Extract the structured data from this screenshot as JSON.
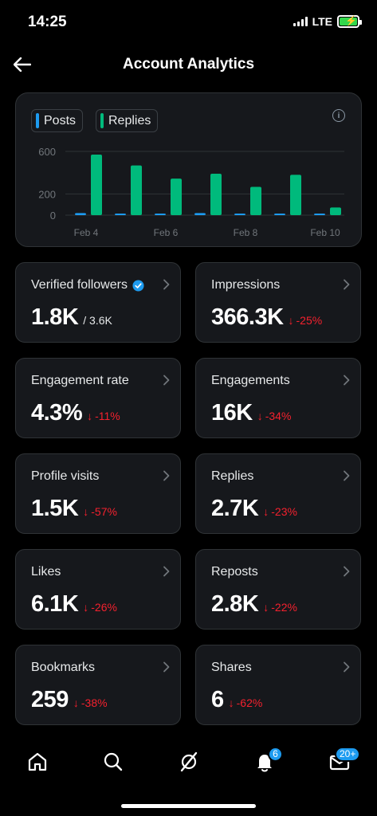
{
  "status_bar": {
    "time": "14:25",
    "network": "LTE"
  },
  "header": {
    "title": "Account Analytics"
  },
  "chart": {
    "legend": [
      {
        "label": "Posts",
        "color": "#1d9bf0"
      },
      {
        "label": "Replies",
        "color": "#00ba7c"
      }
    ]
  },
  "chart_data": {
    "type": "bar",
    "categories": [
      "Feb 4",
      "Feb 5",
      "Feb 6",
      "Feb 7",
      "Feb 8",
      "Feb 9",
      "Feb 10"
    ],
    "x_tick_labels": [
      "Feb 4",
      "Feb 6",
      "Feb 8",
      "Feb 10"
    ],
    "y_tick_labels": [
      "600",
      "200",
      "0"
    ],
    "ylim": [
      0,
      600
    ],
    "series": [
      {
        "name": "Posts",
        "color": "#1d9bf0",
        "values": [
          20,
          15,
          15,
          20,
          10,
          12,
          8
        ]
      },
      {
        "name": "Replies",
        "color": "#00ba7c",
        "values": [
          570,
          468,
          344,
          390,
          266,
          380,
          72
        ]
      }
    ],
    "grid": true
  },
  "metrics": [
    {
      "label": "Verified followers",
      "value": "1.8K",
      "sub": "/ 3.6K",
      "change": "",
      "verified": true
    },
    {
      "label": "Impressions",
      "value": "366.3K",
      "sub": "",
      "change": "-25%"
    },
    {
      "label": "Engagement rate",
      "value": "4.3%",
      "sub": "",
      "change": "-11%"
    },
    {
      "label": "Engagements",
      "value": "16K",
      "sub": "",
      "change": "-34%"
    },
    {
      "label": "Profile visits",
      "value": "1.5K",
      "sub": "",
      "change": "-57%"
    },
    {
      "label": "Replies",
      "value": "2.7K",
      "sub": "",
      "change": "-23%"
    },
    {
      "label": "Likes",
      "value": "6.1K",
      "sub": "",
      "change": "-26%"
    },
    {
      "label": "Reposts",
      "value": "2.8K",
      "sub": "",
      "change": "-22%"
    },
    {
      "label": "Bookmarks",
      "value": "259",
      "sub": "",
      "change": "-38%"
    },
    {
      "label": "Shares",
      "value": "6",
      "sub": "",
      "change": "-62%"
    }
  ],
  "bottom_nav": {
    "items": [
      "home-icon",
      "search-icon",
      "grok-icon",
      "bell-icon",
      "mail-icon"
    ],
    "notifications_badge": "6",
    "messages_badge": "20+"
  }
}
